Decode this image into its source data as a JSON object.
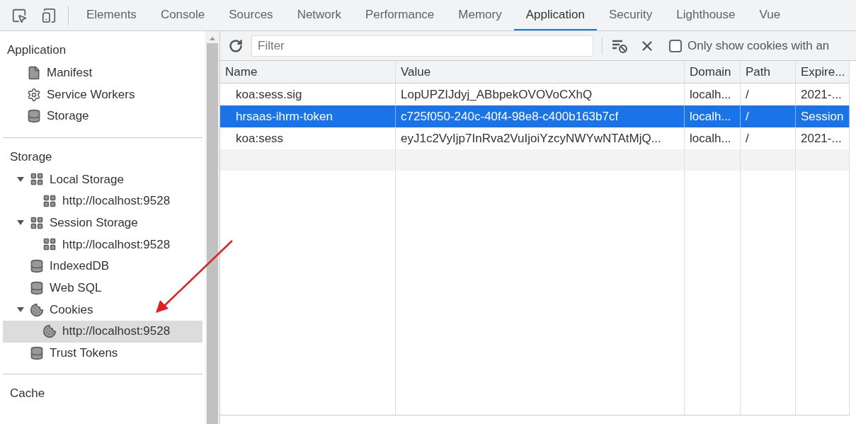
{
  "tabs": [
    {
      "label": "Elements",
      "selected": false
    },
    {
      "label": "Console",
      "selected": false
    },
    {
      "label": "Sources",
      "selected": false
    },
    {
      "label": "Network",
      "selected": false
    },
    {
      "label": "Performance",
      "selected": false
    },
    {
      "label": "Memory",
      "selected": false
    },
    {
      "label": "Application",
      "selected": true
    },
    {
      "label": "Security",
      "selected": false
    },
    {
      "label": "Lighthouse",
      "selected": false
    },
    {
      "label": "Vue",
      "selected": false
    }
  ],
  "sidebar": {
    "sections": [
      {
        "title": "Application",
        "items": [
          {
            "label": "Manifest",
            "kind": "file",
            "selected": false
          },
          {
            "label": "Service Workers",
            "kind": "gear",
            "selected": false
          },
          {
            "label": "Storage",
            "kind": "database",
            "selected": false
          }
        ]
      },
      {
        "title": "Storage",
        "items": [
          {
            "label": "Local Storage",
            "kind": "grid",
            "selected": false,
            "expanded": true,
            "children": [
              {
                "label": "http://localhost:9528",
                "kind": "grid",
                "selected": false
              }
            ]
          },
          {
            "label": "Session Storage",
            "kind": "grid",
            "selected": false,
            "expanded": true,
            "children": [
              {
                "label": "http://localhost:9528",
                "kind": "grid",
                "selected": false
              }
            ]
          },
          {
            "label": "IndexedDB",
            "kind": "database",
            "selected": false
          },
          {
            "label": "Web SQL",
            "kind": "database",
            "selected": false
          },
          {
            "label": "Cookies",
            "kind": "cookie",
            "selected": false,
            "expanded": true,
            "children": [
              {
                "label": "http://localhost:9528",
                "kind": "cookie",
                "selected": true
              }
            ]
          },
          {
            "label": "Trust Tokens",
            "kind": "database",
            "selected": false
          }
        ]
      },
      {
        "title": "Cache"
      }
    ]
  },
  "toolbar": {
    "filter_placeholder": "Filter",
    "only_show_cookies": {
      "label": "Only show cookies with an",
      "checked": false
    }
  },
  "table": {
    "columns": [
      "Name",
      "Value",
      "Domain",
      "Path",
      "Expire..."
    ],
    "rows": [
      {
        "cells": [
          "koa:sess.sig",
          "LopUPZIJdyj_ABbpekOVOVoCXhQ",
          "localh...",
          "/",
          "2021-..."
        ],
        "selected": false
      },
      {
        "cells": [
          "hrsaas-ihrm-token",
          "c725f050-240c-40f4-98e8-c400b163b7cf",
          "localh...",
          "/",
          "Session"
        ],
        "selected": true
      },
      {
        "cells": [
          "koa:sess",
          "eyJ1c2VyIjp7InRva2VuIjoiYzcyNWYwNTAtMjQ...",
          "localh...",
          "/",
          "2021-..."
        ],
        "selected": false
      }
    ]
  }
}
